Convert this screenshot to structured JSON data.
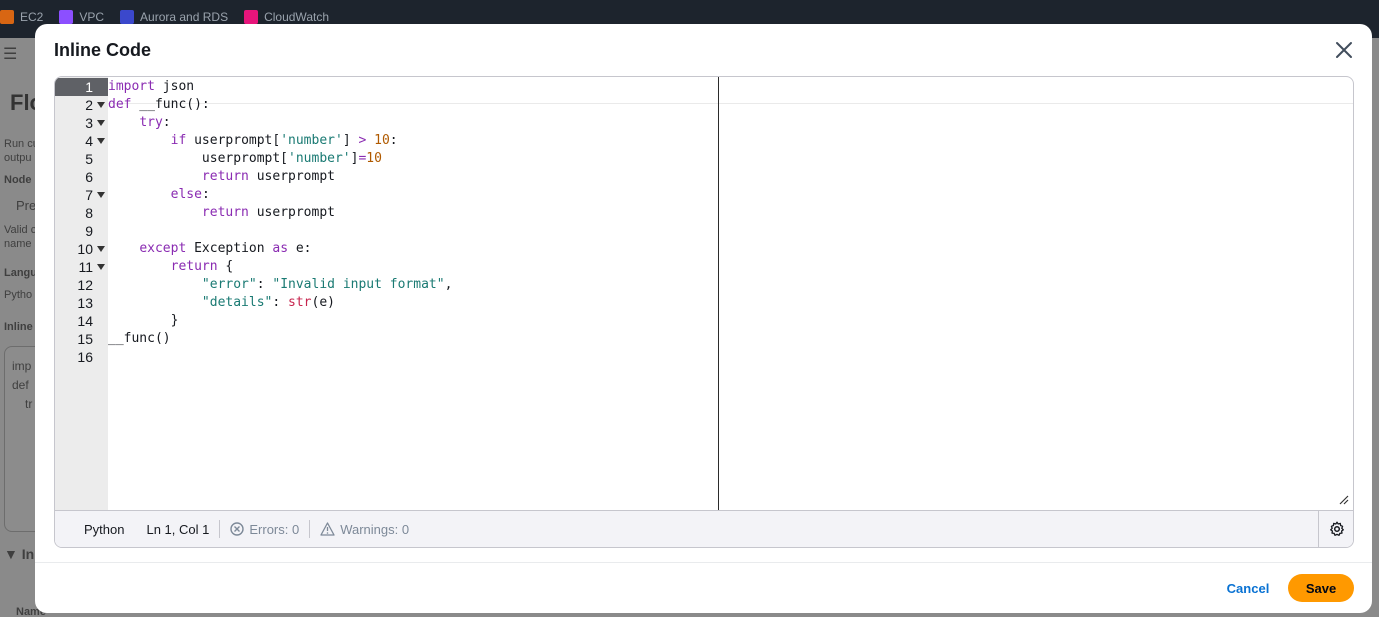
{
  "topbar": {
    "services": [
      {
        "label": "EC2",
        "icon": "ec2-icon",
        "color": "#d86613"
      },
      {
        "label": "VPC",
        "icon": "vpc-icon",
        "color": "#8c4fff"
      },
      {
        "label": "Aurora and RDS",
        "icon": "rds-icon",
        "color": "#3b48cc"
      },
      {
        "label": "CloudWatch",
        "icon": "cloudwatch-icon",
        "color": "#e7157b"
      }
    ]
  },
  "background": {
    "page_title_fragment": "Flo",
    "run_text": "Run cu",
    "output_text": "outpu",
    "node_label": "Node n",
    "input_fragment": "Pre",
    "valid_text": "Valid c",
    "name_text": "name",
    "language_label": "Langu",
    "language_value": "Pytho",
    "inline_label": "Inline",
    "code_line1": "imp",
    "code_line2": "def",
    "code_line3": "tr",
    "section_fragment": "In",
    "name_col": "Name"
  },
  "modal": {
    "title": "Inline Code",
    "cancel_label": "Cancel",
    "save_label": "Save"
  },
  "editor": {
    "line_numbers": [
      "1",
      "2",
      "3",
      "4",
      "5",
      "6",
      "7",
      "8",
      "9",
      "10",
      "11",
      "12",
      "13",
      "14",
      "15",
      "16"
    ],
    "fold_lines": [
      2,
      3,
      4,
      7,
      10,
      11
    ],
    "active_line": 1,
    "status": {
      "language": "Python",
      "cursor": "Ln 1, Col 1",
      "errors": "Errors: 0",
      "warnings": "Warnings: 0"
    }
  },
  "colors": {
    "accent": "#0972d3",
    "primary_button": "#ff9900",
    "keyword": "#8a2bb2",
    "string": "#1a7a73",
    "number": "#b05a00"
  }
}
